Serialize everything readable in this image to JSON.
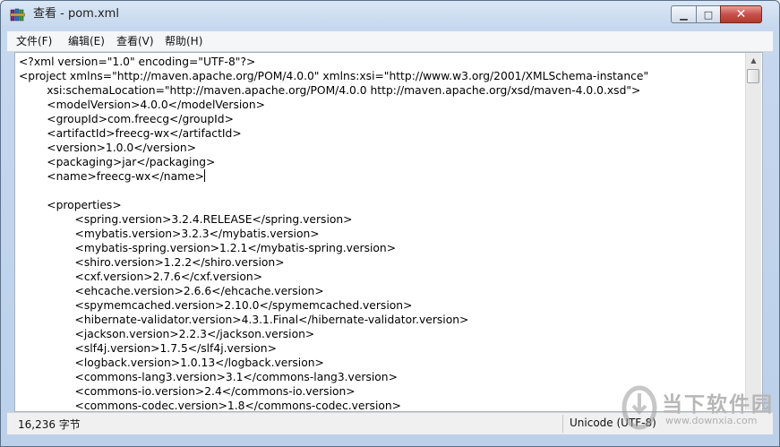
{
  "window": {
    "title": "查看 - pom.xml",
    "min_glyph": "▁",
    "max_glyph": "□",
    "close_glyph": "✕"
  },
  "menu": {
    "file": "文件(F)",
    "edit": "编辑(E)",
    "view": "查看(V)",
    "help": "帮助(H)"
  },
  "editor": {
    "lines": [
      "<?xml version=\"1.0\" encoding=\"UTF-8\"?>",
      "<project xmlns=\"http://maven.apache.org/POM/4.0.0\" xmlns:xsi=\"http://www.w3.org/2001/XMLSchema-instance\"",
      "        xsi:schemaLocation=\"http://maven.apache.org/POM/4.0.0 http://maven.apache.org/xsd/maven-4.0.0.xsd\">",
      "        <modelVersion>4.0.0</modelVersion>",
      "        <groupId>com.freecg</groupId>",
      "        <artifactId>freecg-wx</artifactId>",
      "        <version>1.0.0</version>",
      "        <packaging>jar</packaging>",
      "        <name>freecg-wx</name>",
      "",
      "        <properties>",
      "                <spring.version>3.2.4.RELEASE</spring.version>",
      "                <mybatis.version>3.2.3</mybatis.version>",
      "                <mybatis-spring.version>1.2.1</mybatis-spring.version>",
      "                <shiro.version>1.2.2</shiro.version>",
      "                <cxf.version>2.7.6</cxf.version>",
      "                <ehcache.version>2.6.6</ehcache.version>",
      "                <spymemcached.version>2.10.0</spymemcached.version>",
      "                <hibernate-validator.version>4.3.1.Final</hibernate-validator.version>",
      "                <jackson.version>2.2.3</jackson.version>",
      "                <slf4j.version>1.7.5</slf4j.version>",
      "                <logback.version>1.0.13</logback.version>",
      "                <commons-lang3.version>3.1</commons-lang3.version>",
      "                <commons-io.version>2.4</commons-io.version>",
      "                <commons-codec.version>1.8</commons-codec.version>"
    ]
  },
  "status": {
    "size": "16,236 字节",
    "encoding": "Unicode (UTF-8)"
  },
  "watermark": {
    "name": "当下软件园",
    "url": "www.downxia.com"
  }
}
